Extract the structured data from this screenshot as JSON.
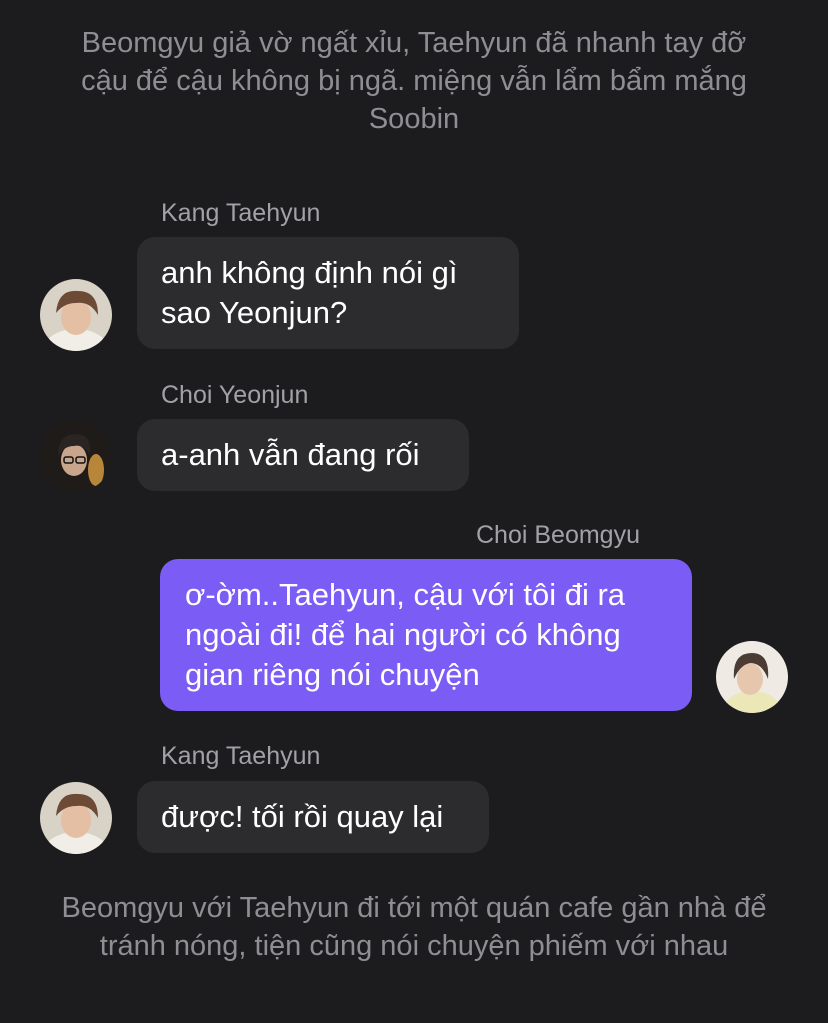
{
  "narration_top": "Beomgyu giả vờ ngất xỉu, Taehyun đã nhanh tay đỡ cậu để cậu không bị ngã. miệng vẫn lẩm bẩm mắng Soobin",
  "messages": [
    {
      "sender": "Kang Taehyun",
      "text": "anh không định nói gì sao Yeonjun?",
      "mine": false
    },
    {
      "sender": "Choi Yeonjun",
      "text": "a-anh vẫn đang rối",
      "mine": false
    },
    {
      "sender": "Choi Beomgyu",
      "text": "ơ-ờm..Taehyun, cậu với tôi đi ra ngoài đi! để hai người có không gian riêng nói chuyện",
      "mine": true
    },
    {
      "sender": "Kang Taehyun",
      "text": "được! tối rồi quay lại",
      "mine": false
    }
  ],
  "narration_bottom": "Beomgyu với Taehyun đi tới một quán cafe gần nhà để tránh nóng, tiện cũng nói chuyện phiếm với nhau",
  "colors": {
    "background": "#1c1c1e",
    "bubble_other": "#2c2c2e",
    "bubble_mine": "#7b5cf5",
    "narration_text": "#8e8e93",
    "sender_text": "#a1a1a6"
  }
}
